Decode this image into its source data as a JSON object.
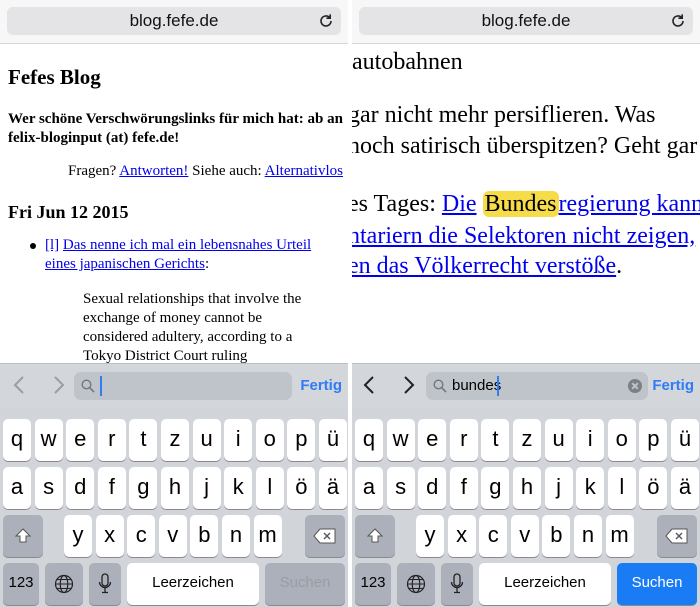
{
  "left": {
    "url": "blog.fefe.de",
    "blog_title": "Fefes Blog",
    "tagline": "Wer schöne Verschwörungslinks für mich hat: ab an felix-bloginput (at) fefe.de!",
    "fragen_prefix": "Fragen?",
    "fragen_link": "Antworten!",
    "siehe_prefix": "Siehe auch:",
    "siehe_link": "Alternativlos",
    "date": "Fri Jun 12 2015",
    "entry_marker": "[l]",
    "entry_link": "Das nenne ich mal ein lebensnahes Urteil eines japanischen Gerichts",
    "entry_suffix": ":",
    "quote": "Sexual relationships that involve the exchange of money cannot be considered adultery, according to a Tokyo District Court ruling",
    "find_query": "",
    "done_label": "Fertig",
    "space_label": "Leerzeichen",
    "search_label": "Suchen",
    "numbers_label": "123"
  },
  "right": {
    "url": "blog.fefe.de",
    "line1": "autobahnen",
    "line2": "gar nicht mehr persiflieren. Was",
    "line3": "noch satirisch überspitzen? Geht gar",
    "line4_prefix": "es Tages:",
    "line4_link_a": "Die",
    "line4_highlight": "Bundes",
    "line4_link_b": "regierung kann",
    "line5_link": "ntariern die Selektoren nicht zeigen,",
    "line6_link": "en das Völkerrecht verstöße",
    "line6_suffix": ".",
    "find_query": "bundes",
    "done_label": "Fertig",
    "space_label": "Leerzeichen",
    "search_label": "Suchen",
    "numbers_label": "123"
  },
  "keyboard_rows": {
    "row1": [
      "q",
      "w",
      "e",
      "r",
      "t",
      "z",
      "u",
      "i",
      "o",
      "p",
      "ü"
    ],
    "row2": [
      "a",
      "s",
      "d",
      "f",
      "g",
      "h",
      "j",
      "k",
      "l",
      "ö",
      "ä"
    ],
    "row3": [
      "y",
      "x",
      "c",
      "v",
      "b",
      "n",
      "m"
    ]
  },
  "colors": {
    "link": "#0000ee",
    "highlight": "#f7dc4a",
    "accent": "#1a7cf5"
  },
  "icons": [
    "reload-icon",
    "back-arrow-icon",
    "forward-arrow-icon",
    "magnifier-icon",
    "clear-icon",
    "shift-icon",
    "backspace-icon",
    "globe-icon",
    "microphone-icon"
  ]
}
